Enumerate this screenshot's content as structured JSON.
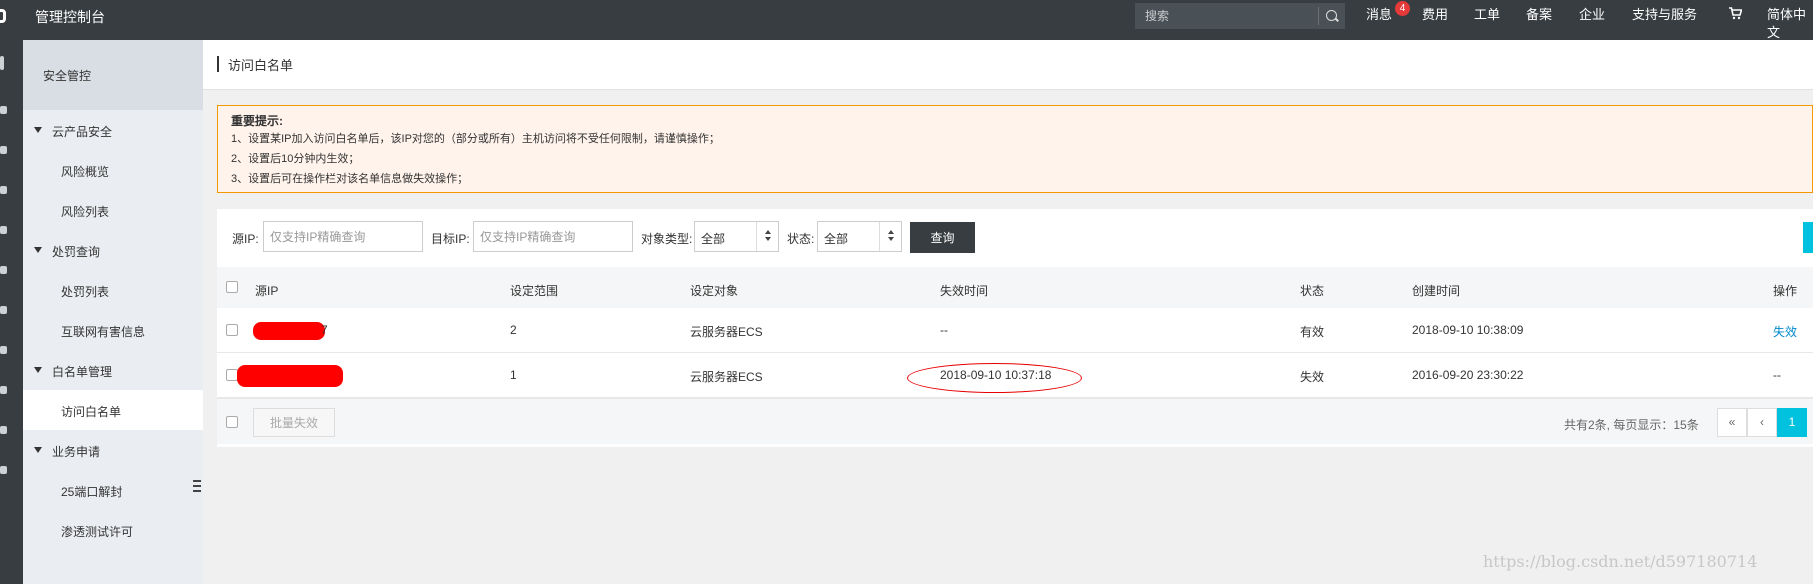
{
  "topbar": {
    "title": "管理控制台",
    "search_placeholder": "搜索",
    "nav": [
      "消息",
      "费用",
      "工单",
      "备案",
      "企业",
      "支持与服务",
      "简体中文"
    ],
    "message_badge": "4",
    "bg_color": "#373d41"
  },
  "sidebar": {
    "header": "安全管控",
    "groups": [
      {
        "label": "云产品安全",
        "items": [
          "风险概览",
          "风险列表"
        ]
      },
      {
        "label": "处罚查询",
        "items": [
          "处罚列表",
          "互联网有害信息"
        ]
      },
      {
        "label": "白名单管理",
        "items": [
          "访问白名单"
        ]
      },
      {
        "label": "业务申请",
        "items": [
          "25端口解封",
          "渗透测试许可"
        ]
      }
    ],
    "active_item": "访问白名单"
  },
  "page": {
    "title": "访问白名单"
  },
  "notice": {
    "heading": "重要提示:",
    "lines": [
      "1、设置某IP加入访问白名单后，该IP对您的（部分或所有）主机访问将不受任何限制，请谨慎操作；",
      "2、设置后10分钟内生效；",
      "3、设置后可在操作栏对该名单信息做失效操作；"
    ],
    "border_color": "#f39800",
    "bg_color": "#fff3eb"
  },
  "filters": {
    "source_ip_label": "源IP:",
    "source_ip_placeholder": "仅支持IP精确查询",
    "target_ip_label": "目标IP:",
    "target_ip_placeholder": "仅支持IP精确查询",
    "type_label": "对象类型:",
    "type_value": "全部",
    "status_label": "状态:",
    "status_value": "全部",
    "query_button": "查询"
  },
  "table": {
    "columns": [
      "源IP",
      "设定范围",
      "设定对象",
      "失效时间",
      "状态",
      "创建时间",
      "操作"
    ],
    "rows": [
      {
        "source_ip": "7",
        "scope": "2",
        "target": "云服务器ECS",
        "expire_time": "--",
        "status": "有效",
        "created": "2018-09-10 10:38:09",
        "action": "失效"
      },
      {
        "source_ip": "",
        "scope": "1",
        "target": "云服务器ECS",
        "expire_time": "2018-09-10 10:37:18",
        "status": "失效",
        "created": "2016-09-20 23:30:22",
        "action": "--"
      }
    ]
  },
  "footer": {
    "batch_button": "批量失效",
    "pagination_info": "共有2条, 每页显示：15条",
    "pager": [
      "«",
      "‹",
      "1"
    ],
    "accent_color": "#00c1de"
  },
  "watermark": "https://blog.csdn.net/d597180714"
}
